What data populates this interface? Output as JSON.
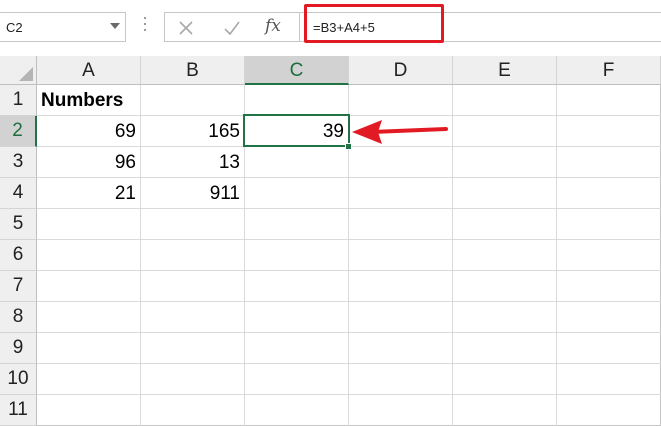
{
  "name_box": {
    "value": "C2"
  },
  "formula_bar": {
    "cancel_icon": "close-icon",
    "enter_icon": "check-icon",
    "function_label": "fx",
    "formula": "=B3+A4+5"
  },
  "columns": [
    "A",
    "B",
    "C",
    "D",
    "E",
    "F"
  ],
  "selected_column": "C",
  "rows": [
    "1",
    "2",
    "3",
    "4",
    "5",
    "6",
    "7",
    "8",
    "9",
    "10",
    "11"
  ],
  "selected_row": "2",
  "cells": {
    "A1": "Numbers",
    "A2": "69",
    "B2": "165",
    "C2": "39",
    "A3": "96",
    "B3": "13",
    "A4": "21",
    "B4": "911"
  },
  "colors": {
    "accent_green": "#217346",
    "annotation_red": "#e21a23"
  }
}
